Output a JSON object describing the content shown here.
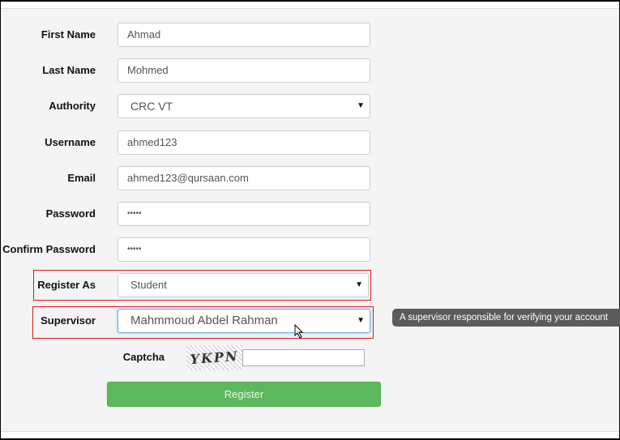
{
  "form": {
    "first_name": {
      "label": "First Name",
      "value": "Ahmad"
    },
    "last_name": {
      "label": "Last Name",
      "value": "Mohmed"
    },
    "authority": {
      "label": "Authority",
      "value": "CRC VT"
    },
    "username": {
      "label": "Username",
      "value": "ahmed123"
    },
    "email": {
      "label": "Email",
      "value": "ahmed123@qursaan.com"
    },
    "password": {
      "label": "Password",
      "value": "•••••"
    },
    "confirm_password": {
      "label": "Confirm Password",
      "value": "•••••"
    },
    "register_as": {
      "label": "Register As",
      "value": "Student"
    },
    "supervisor": {
      "label": "Supervisor",
      "value": "Mahmmoud Abdel Rahman",
      "tooltip": "A supervisor responsible for verifying your account"
    },
    "captcha": {
      "label": "Captcha",
      "image_text": "YKPN",
      "value": ""
    },
    "register_label": "Register"
  }
}
